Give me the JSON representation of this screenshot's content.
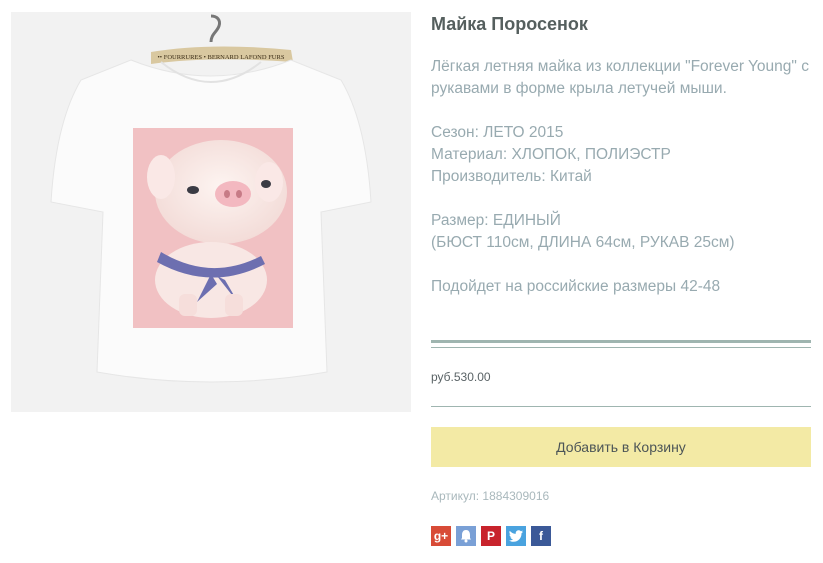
{
  "product": {
    "title": "Майка Поросенок",
    "image_alt": "Product photo: white T-shirt with pink piglet print",
    "hanger_label": "•• FOURRURES • BERNARD LAFOND FURS",
    "description": "Лёгкая летняя майка из коллекции \"Forever Young\" с рукавами в форме крыла летучей мыши.",
    "season": "Сезон: ЛЕТО 2015",
    "material": "Материал: ХЛОПОК, ПОЛИЭСТР",
    "manufacturer": "Производитель: Китай",
    "size": "Размер: ЕДИНЫЙ",
    "dimensions": "(БЮСТ 110см, ДЛИНА 64см, РУКАВ 25см)",
    "fit": "Подойдет на российские размеры 42-48",
    "price": "руб.530.00",
    "add_to_cart_label": "Добавить в Корзину",
    "sku_label": "Артикул:",
    "sku_value": "1884309016"
  },
  "share": [
    {
      "name": "google-plus-icon",
      "glyph": "g+",
      "color": "#d84b37"
    },
    {
      "name": "vkontakte-icon",
      "glyph": "🔔",
      "color": "#7aa0d6"
    },
    {
      "name": "pinterest-icon",
      "glyph": "P",
      "color": "#c8232c"
    },
    {
      "name": "twitter-icon",
      "glyph": "t",
      "color": "#4aa3df"
    },
    {
      "name": "facebook-icon",
      "glyph": "f",
      "color": "#3b5998"
    }
  ],
  "colors": {
    "accent_rule": "#9fb5b0",
    "cart_button": "#f3eaa5",
    "text_muted": "#98aab0"
  }
}
